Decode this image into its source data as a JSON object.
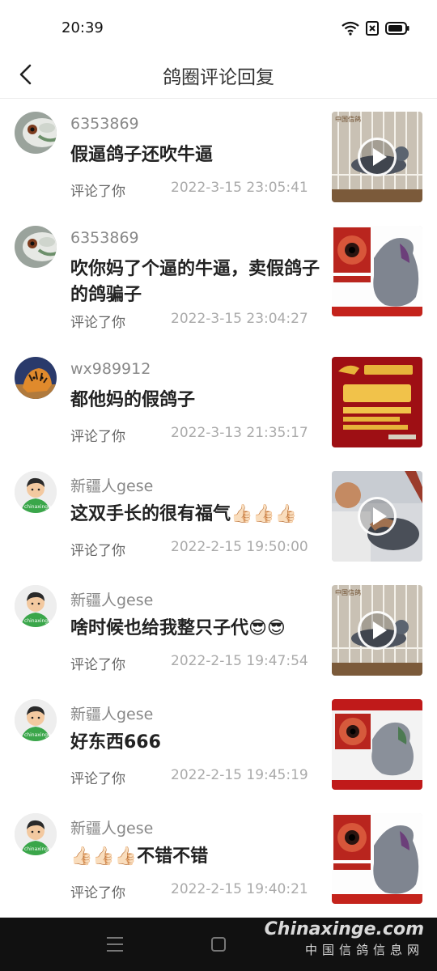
{
  "status_bar": {
    "time": "20:39",
    "battery_icon": "battery-icon",
    "wifi_icon": "wifi-icon"
  },
  "header": {
    "title": "鸽圈评论回复",
    "back_icon": "chevron-left-icon"
  },
  "comments": [
    {
      "username": "6353869",
      "text": "假逼鸽子还吹牛逼",
      "action": "评论了你",
      "time": "2022-3-15 23:05:41",
      "avatar": "pigeon-eye",
      "thumb": "video-cage",
      "is_video": true
    },
    {
      "username": "6353869",
      "text": "吹你妈了个逼的牛逼，卖假鸽子的鸽骗子",
      "action": "评论了你",
      "time": "2022-3-15 23:04:27",
      "avatar": "pigeon-eye",
      "thumb": "pigeon-poster",
      "is_video": false
    },
    {
      "username": "wx989912",
      "text": "都他妈的假鸽子",
      "action": "评论了你",
      "time": "2022-3-13 21:35:17",
      "avatar": "tiger",
      "thumb": "red-loft-banner",
      "is_video": false
    },
    {
      "username": "新疆人gese",
      "text": "这双手长的很有福气👍🏻👍🏻👍🏻",
      "action": "评论了你",
      "time": "2022-2-15 19:50:00",
      "avatar": "cartoon-man",
      "thumb": "video-hands",
      "is_video": true
    },
    {
      "username": "新疆人gese",
      "text": "啥时候也给我整只子代😎😎",
      "action": "评论了你",
      "time": "2022-2-15 19:47:54",
      "avatar": "cartoon-man",
      "thumb": "video-cage",
      "is_video": true
    },
    {
      "username": "新疆人gese",
      "text": "好东西666",
      "action": "评论了你",
      "time": "2022-2-15 19:45:19",
      "avatar": "cartoon-man",
      "thumb": "pigeon-poster-red",
      "is_video": false
    },
    {
      "username": "新疆人gese",
      "text": "👍🏻👍🏻👍🏻不错不错",
      "action": "评论了你",
      "time": "2022-2-15 19:40:21",
      "avatar": "cartoon-man",
      "thumb": "pigeon-poster",
      "is_video": false
    }
  ],
  "nav_bar": {
    "menu_icon": "menu-icon",
    "home_icon": "home-square-icon"
  },
  "watermark": {
    "main": "Chinaxinge.com",
    "sub": "中国信鸽信息网"
  },
  "colors": {
    "text_primary": "#222222",
    "text_secondary": "#999999",
    "nav_bar": "#111111"
  }
}
